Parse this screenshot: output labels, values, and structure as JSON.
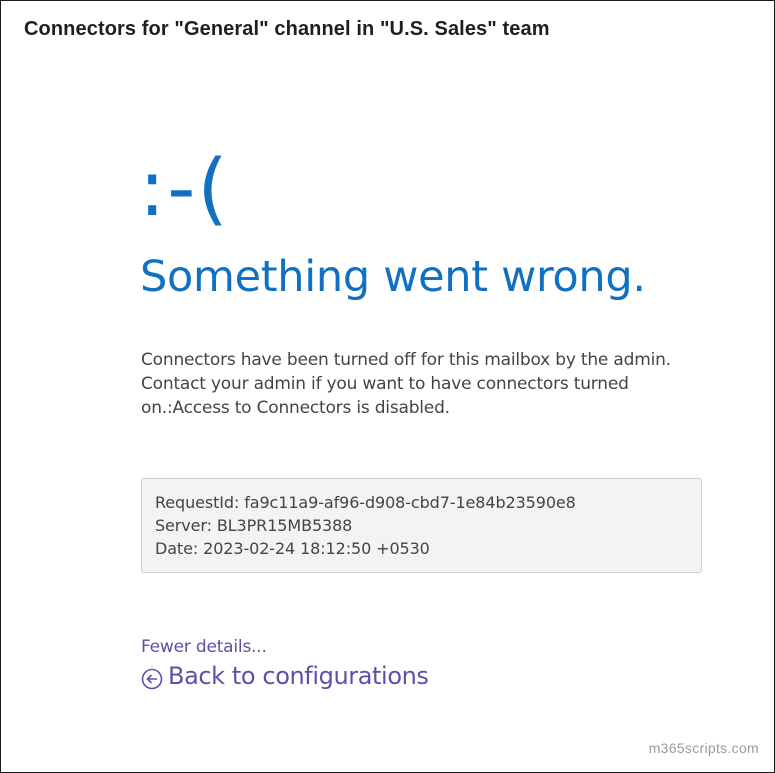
{
  "dialog": {
    "title": "Connectors for \"General\" channel in \"U.S. Sales\" team"
  },
  "error": {
    "emoticon": ":-(",
    "headline": "Something went wrong.",
    "message": "Connectors have been turned off for this mailbox by the admin. Contact your admin if you want to have connectors turned on.:Access to Connectors is disabled."
  },
  "details": {
    "request_id": "RequestId: fa9c11a9-af96-d908-cbd7-1e84b23590e8",
    "server": "Server: BL3PR15MB5388",
    "date": "Date: 2023-02-24 18:12:50 +0530"
  },
  "links": {
    "fewer_details": "Fewer details...",
    "back": "Back to configurations"
  },
  "icons": {
    "back": "back-arrow-circle-icon"
  },
  "colors": {
    "accent_blue": "#1170c1",
    "link_purple": "#5a52a8",
    "body_text": "#444444",
    "details_bg": "#f3f3f3"
  },
  "watermark": "m365scripts.com"
}
